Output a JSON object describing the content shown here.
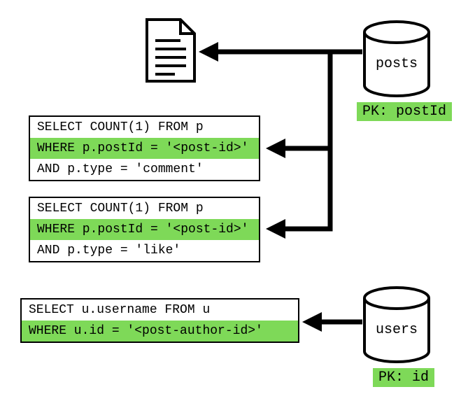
{
  "databases": {
    "posts": {
      "label": "posts",
      "pk": "PK: postId"
    },
    "users": {
      "label": "users",
      "pk": "PK: id"
    }
  },
  "queries": {
    "q1": {
      "line1": "SELECT COUNT(1) FROM p",
      "line2": "WHERE p.postId = '<post-id>'",
      "line3": "AND p.type = 'comment'"
    },
    "q2": {
      "line1": "SELECT COUNT(1) FROM p",
      "line2": "WHERE p.postId = '<post-id>'",
      "line3": "AND p.type = 'like'"
    },
    "q3": {
      "line1": "SELECT u.username FROM u",
      "line2": "WHERE u.id = '<post-author-id>'"
    }
  }
}
